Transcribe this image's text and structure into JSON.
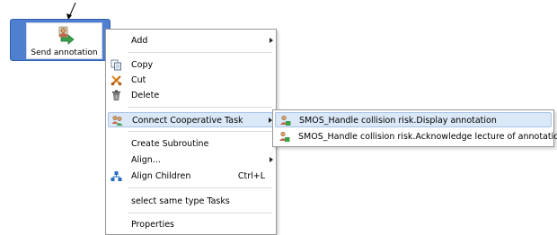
{
  "task_node": {
    "label": "Send annotation",
    "icon": "send-annotation-icon"
  },
  "context_menu": {
    "add": {
      "label": "Add",
      "has_submenu": true
    },
    "copy": {
      "label": "Copy",
      "icon": "copy-icon"
    },
    "cut": {
      "label": "Cut",
      "icon": "cut-icon"
    },
    "delete": {
      "label": "Delete",
      "icon": "delete-icon"
    },
    "connect_cooperative_task": {
      "label": "Connect Cooperative Task",
      "icon": "cooperative-task-icon",
      "has_submenu": true,
      "highlighted": true
    },
    "create_subroutine": {
      "label": "Create Subroutine"
    },
    "align": {
      "label": "Align...",
      "has_submenu": true
    },
    "align_children": {
      "label": "Align Children",
      "shortcut": "Ctrl+L",
      "icon": "align-children-icon"
    },
    "select_same_type": {
      "label": "select same type Tasks"
    },
    "properties": {
      "label": "Properties"
    }
  },
  "submenu": {
    "items": [
      {
        "label": "SMOS_Handle collision risk.Display annotation",
        "icon": "cooperative-task-icon",
        "highlighted": true
      },
      {
        "label": "SMOS_Handle collision risk.Acknowledge lecture of annotation",
        "icon": "cooperative-task-icon"
      }
    ]
  },
  "colors": {
    "node_blue": "#4f7fcf",
    "highlight": "#dbe8f7",
    "highlight_border": "#a8c4e8"
  }
}
